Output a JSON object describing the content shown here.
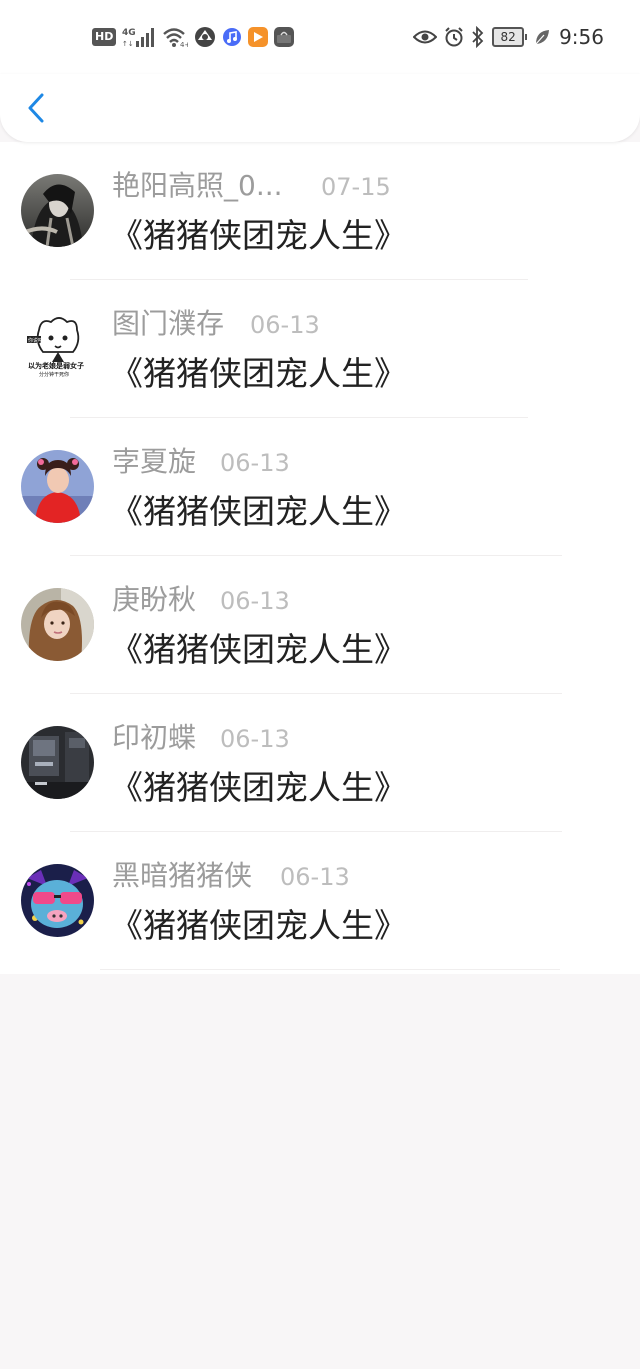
{
  "status_bar": {
    "hd": "HD",
    "network": "4G",
    "battery": "82",
    "time": "9:56",
    "icons": [
      "hd-icon",
      "signal-icon",
      "wifi-icon",
      "vpn-icon",
      "music-app-icon",
      "video-app-icon",
      "huawei-app-icon",
      "eye-comfort-icon",
      "alarm-icon",
      "bluetooth-icon",
      "battery-icon",
      "leaf-icon"
    ]
  },
  "nav": {
    "back_icon": "chevron-left-icon",
    "accent": "#1e88e5"
  },
  "items": [
    {
      "name": "艳阳高照_0...",
      "date": "07-15",
      "title": "《猪猪侠团宠人生》"
    },
    {
      "name": "图门濮存",
      "date": "06-13",
      "title": "《猪猪侠团宠人生》"
    },
    {
      "name": "孛夏旋",
      "date": "06-13",
      "title": "《猪猪侠团宠人生》"
    },
    {
      "name": "庚盼秋",
      "date": "06-13",
      "title": "《猪猪侠团宠人生》"
    },
    {
      "name": "印初蝶",
      "date": "06-13",
      "title": "《猪猪侠团宠人生》"
    },
    {
      "name": "黑暗猪猪侠",
      "date": "06-13",
      "title": "《猪猪侠团宠人生》"
    }
  ],
  "avatar_meme_text": {
    "line1": "以为老娘是弱女子",
    "line2": "分分钟干死你",
    "badge": "你说啥"
  }
}
